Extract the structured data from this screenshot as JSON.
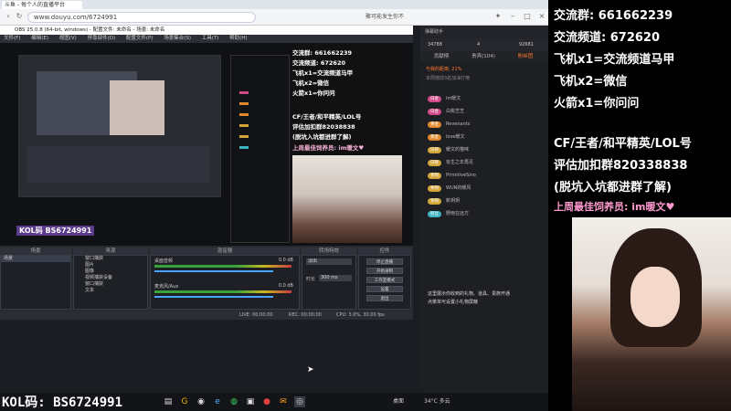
{
  "browser": {
    "tab_title": "斗鱼 - 每个人的直播平台",
    "url": "www.douyu.com/6724991",
    "promo": "聚可能发生你不"
  },
  "obs": {
    "title": "OBS 25.0.8 (64-bit, windows) - 配置文件: 未命名 - 场景: 未命名",
    "menu": [
      "文件(F)",
      "编辑(E)",
      "视图(V)",
      "停靠部件(D)",
      "配置文件(P)",
      "场景集合(S)",
      "工具(T)",
      "帮助(H)"
    ],
    "scene_tag": "KOL码 BS6724991",
    "overlay_lines": [
      "交流群: 661662239",
      "交流频道: 672620",
      "飞机x1=交流频道马甲",
      "飞机x2=微信",
      "火箭x1=你问问"
    ],
    "overlay_cf": [
      "CF/王者/和平精英/LOL号",
      "评估加扣群82038838",
      "(脱坑入坑都进群了解)"
    ],
    "overlay_top_fan": "上周最佳饲养员: im暖文♥",
    "docks": {
      "scenes": "场景",
      "sources": "来源",
      "mixer": "混音器",
      "transitions": "转场特效",
      "controls": "控件"
    },
    "scene_item": "场景",
    "sources_list": [
      "窗口捕获",
      "图片",
      "图像",
      "视频捕获设备",
      "窗口捕获",
      "文本"
    ],
    "mixer": [
      {
        "name": "桌面音频",
        "db": "0.0 dB",
        "level": 0.62
      },
      {
        "name": "麦克风/Aux",
        "db": "0.0 dB",
        "level": 0.55
      }
    ],
    "transition_name": "淡出",
    "transition_duration_label": "时长",
    "transition_duration": "300 ms",
    "controls": [
      "停止直播",
      "开始录制",
      "工作室模式",
      "设置",
      "退出"
    ],
    "status": {
      "live": "LIVE: 00:00:00",
      "rec": "REC: 00:00:00",
      "cpu": "CPU: 3.0%, 30.00 fps"
    }
  },
  "chat": {
    "header": "弹幕助手",
    "stats": {
      "fans": "34788",
      "online": "4",
      "hot": "92681"
    },
    "tabs": [
      "贡献榜",
      "贵宾(104)",
      "粉丝团"
    ],
    "active_tab": 2,
    "notice_lines": [
      "与我的距离: 21%",
      "本周榜前3名加油打榜"
    ],
    "messages": [
      {
        "badge": "白金",
        "text": "im暖文"
      },
      {
        "badge": "白金",
        "text": "白桃芝芝"
      },
      {
        "badge": "黄金",
        "text": "Revenants"
      },
      {
        "badge": "黄金",
        "text": "love暖文"
      },
      {
        "badge": "白银",
        "text": "暖文的猫咪"
      },
      {
        "badge": "白银",
        "text": "有生之年再见"
      },
      {
        "badge": "青铜",
        "text": "PrimitiveSino"
      },
      {
        "badge": "青铜",
        "text": "WUN的暖风"
      },
      {
        "badge": "青铜",
        "text": "新玥玥"
      },
      {
        "badge": "粉丝",
        "text": "野雨在远方"
      }
    ],
    "footer_lines": [
      "这里展示你收到的礼物、道具、贵族开通",
      "点菜单可设置小礼物屏蔽"
    ]
  },
  "right_overlay": {
    "lines": [
      "交流群: 661662239",
      "交流频道: 672620",
      "飞机x1=交流频道马甲",
      "飞机x2=微信",
      "火箭x1=你问问"
    ],
    "cf_lines": [
      "CF/王者/和平精英/LOL号",
      "评估加扣群820338838",
      "(脱坑入坑都进群了解)"
    ],
    "top_fan": "上周最佳饲养员: im暖文♥"
  },
  "taskbar": {
    "kol_text": "KOL码: BS6724991",
    "weather": "34°C 多云",
    "tray_label": "桌面"
  },
  "colors": {
    "accent": "#d04a8a",
    "obs_bg": "#272a30",
    "chat_bg": "#1e1f23"
  }
}
